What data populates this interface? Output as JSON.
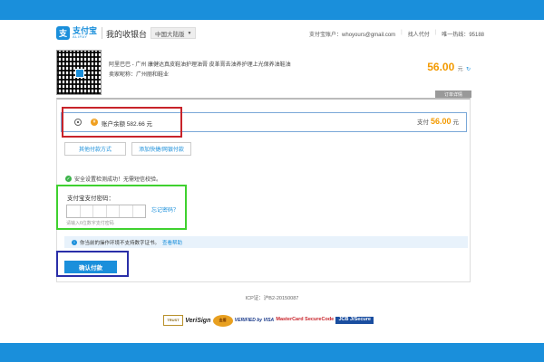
{
  "header": {
    "logo_mark": "支",
    "logo_cn": "支付宝",
    "logo_en": "ALIPAY",
    "title": "我的收银台",
    "region": "中国大陆版",
    "account_label": "支付宝账户：",
    "account_value": "whoyours@gmail.com",
    "pay_on_behalf": "找人代付",
    "hotline_label": "唯一热线：",
    "hotline_value": "95188"
  },
  "order": {
    "line1": "阿里巴巴 - 广州 康健达真皮鞋油护理油膏 皮革膏去油养护理上光保养油鞋油",
    "line2": "卖家昵称：广州丽和鞋业",
    "amount": "56.00",
    "unit": "元",
    "refresh_icon": "↻",
    "detail_tab": "订单详情"
  },
  "payment": {
    "balance_label": "账户余额 582.66 元",
    "pay_label": "支付",
    "pay_amount": "56.00",
    "pay_unit": "元",
    "other_methods": "其他付款方式",
    "add_card": "添加快捷/网银付款",
    "security_text": "安全设置检测成功！无需短信校验。",
    "password_label": "支付宝支付密码：",
    "forgot_password": "忘记密码？",
    "password_hint": "请输入6位数字支付密码",
    "notice_text": "你当前的操作环境不支持数字证书。",
    "notice_link": "查看帮助",
    "confirm_button": "确认付款"
  },
  "footer": {
    "icp": "ICP证：沪B2-20150087",
    "badges": [
      "TRUST",
      "VeriSign",
      "金盾",
      "VERIFIED by VISA",
      "MasterCard SecureCode",
      "JCB J/Secure"
    ]
  },
  "colors": {
    "brand": "#1a8fdb",
    "amount": "#f39a00",
    "highlight_red": "#c8232a",
    "highlight_green": "#3fd12f",
    "highlight_blue": "#2a2fa8"
  }
}
